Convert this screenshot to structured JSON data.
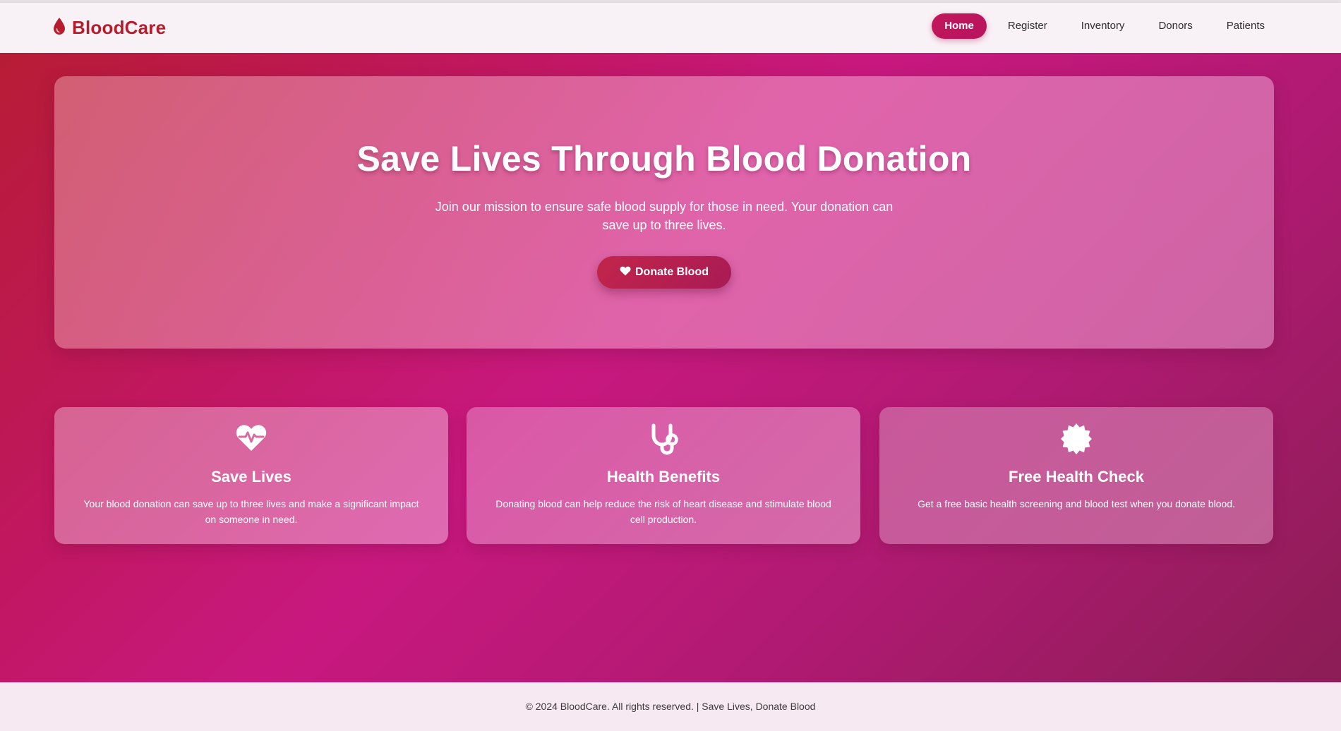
{
  "brand": {
    "name": "BloodCare",
    "icon": "blood-drop-icon"
  },
  "nav": {
    "items": [
      {
        "label": "Home",
        "active": true
      },
      {
        "label": "Register",
        "active": false
      },
      {
        "label": "Inventory",
        "active": false
      },
      {
        "label": "Donors",
        "active": false
      },
      {
        "label": "Patients",
        "active": false
      }
    ]
  },
  "hero": {
    "title": "Save Lives Through Blood Donation",
    "subtitle": "Join our mission to ensure safe blood supply for those in need. Your donation can save up to three lives.",
    "button_label": "Donate Blood",
    "button_icon": "heart-icon"
  },
  "features": [
    {
      "icon": "heartbeat-icon",
      "title": "Save Lives",
      "text": "Your blood donation can save up to three lives and make a significant impact on someone in need."
    },
    {
      "icon": "stethoscope-icon",
      "title": "Health Benefits",
      "text": "Donating blood can help reduce the risk of heart disease and stimulate blood cell production."
    },
    {
      "icon": "badge-check-icon",
      "title": "Free Health Check",
      "text": "Get a free basic health screening and blood test when you donate blood."
    }
  ],
  "footer": {
    "text": "© 2024 BloodCare. All rights reserved. | Save Lives, Donate Blood"
  },
  "colors": {
    "brand": "#b51d2d",
    "accent": "#c2185b",
    "gradient_start": "#b71c35",
    "gradient_mid": "#c8187f",
    "gradient_end": "#8b1d55"
  }
}
